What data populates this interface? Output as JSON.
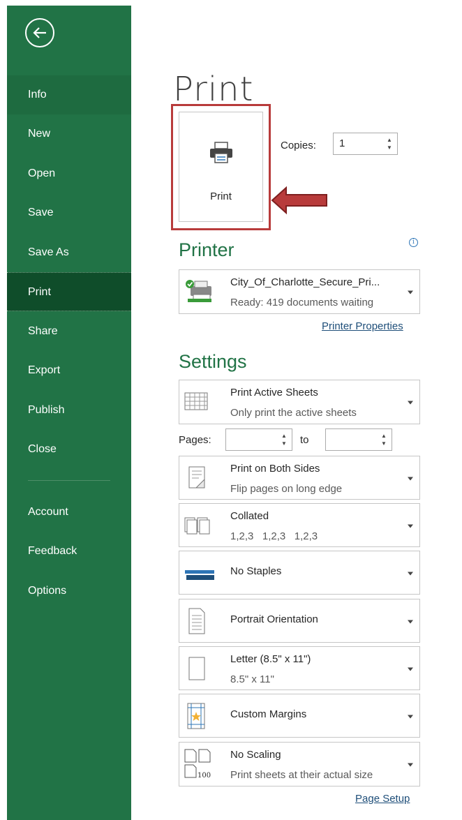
{
  "sidebar": {
    "back_icon": "back-arrow-circle-icon",
    "items": [
      {
        "label": "Info"
      },
      {
        "label": "New"
      },
      {
        "label": "Open"
      },
      {
        "label": "Save"
      },
      {
        "label": "Save As"
      },
      {
        "label": "Print"
      },
      {
        "label": "Share"
      },
      {
        "label": "Export"
      },
      {
        "label": "Publish"
      },
      {
        "label": "Close"
      },
      {
        "label": "Account"
      },
      {
        "label": "Feedback"
      },
      {
        "label": "Options"
      }
    ],
    "active": "Print",
    "color": "#217346"
  },
  "main": {
    "title": "Print",
    "print_button_label": "Print",
    "copies_label": "Copies:",
    "copies_value": "1",
    "highlight_color": "#b83b3b"
  },
  "printer": {
    "heading": "Printer",
    "name": "City_Of_Charlotte_Secure_Pri...",
    "status": "Ready: 419 documents waiting",
    "properties_link": "Printer Properties"
  },
  "settings": {
    "heading": "Settings",
    "pages_label": "Pages:",
    "to_label": "to",
    "items": [
      {
        "line1": "Print Active Sheets",
        "line2": "Only print the active sheets",
        "icon": "sheets-grid-icon"
      },
      {
        "line1": "Print on Both Sides",
        "line2": "Flip pages on long edge",
        "icon": "duplex-icon"
      },
      {
        "line1": "Collated",
        "line2": "1,2,3   1,2,3   1,2,3",
        "icon": "collated-icon"
      },
      {
        "line1": "No Staples",
        "line2": "",
        "icon": "stapler-icon"
      },
      {
        "line1": "Portrait Orientation",
        "line2": "",
        "icon": "portrait-page-icon"
      },
      {
        "line1": "Letter (8.5\" x 11\")",
        "line2": "8.5\" x 11\"",
        "icon": "paper-size-icon"
      },
      {
        "line1": "Custom Margins",
        "line2": "",
        "icon": "margins-icon"
      },
      {
        "line1": "No Scaling",
        "line2": "Print sheets at their actual size",
        "icon": "scaling-icon"
      }
    ],
    "page_setup_link": "Page Setup"
  }
}
